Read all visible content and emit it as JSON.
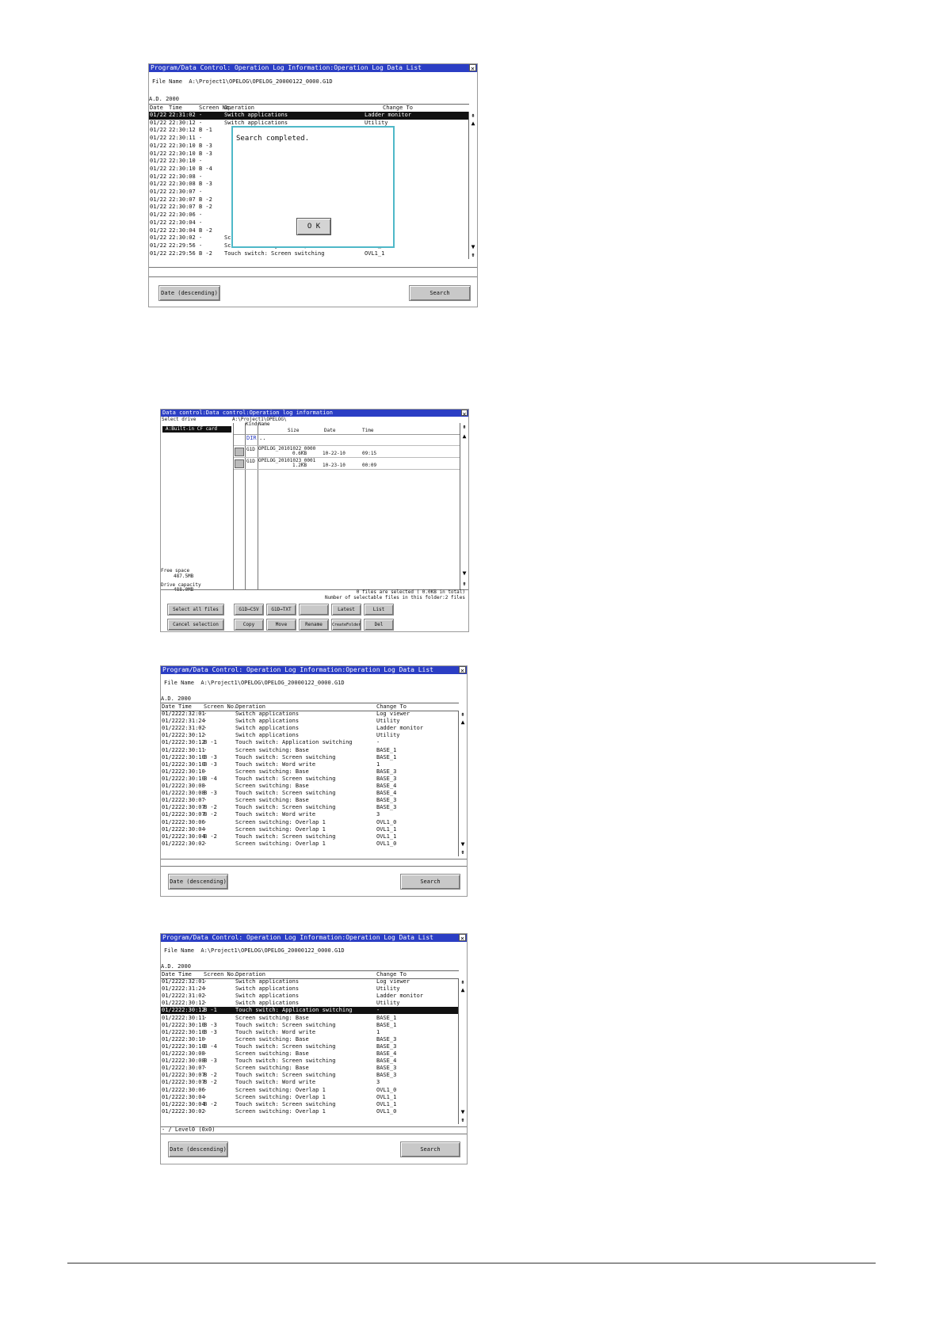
{
  "screen1": {
    "title": "Program/Data Control: Operation Log Information:Operation Log Data List",
    "file_name_label": "File Name",
    "file_name_value": "A:\\Project1\\OPELOG\\OPELOG_20000122_0000.G1D",
    "year": "A.D. 2000",
    "columns": {
      "date": "Date",
      "time": "Time",
      "screen": "Screen No.",
      "operation": "Operation",
      "change": "Change To"
    },
    "rows": [
      {
        "date": "01/22",
        "time": "22:31:02",
        "screen": "-",
        "op": "Switch applications",
        "chg": "Ladder monitor"
      },
      {
        "date": "01/22",
        "time": "22:30:12",
        "screen": "-",
        "op": "Switch applications",
        "chg": "Utility"
      },
      {
        "date": "01/22",
        "time": "22:30:12",
        "screen": "B -1",
        "op": "",
        "chg": ""
      },
      {
        "date": "01/22",
        "time": "22:30:11",
        "screen": "-",
        "op": "",
        "chg": "1"
      },
      {
        "date": "01/22",
        "time": "22:30:10",
        "screen": "B -3",
        "op": "",
        "chg": "1"
      },
      {
        "date": "01/22",
        "time": "22:30:10",
        "screen": "B -3",
        "op": "",
        "chg": ""
      },
      {
        "date": "01/22",
        "time": "22:30:10",
        "screen": "-",
        "op": "",
        "chg": "3"
      },
      {
        "date": "01/22",
        "time": "22:30:10",
        "screen": "B -4",
        "op": "",
        "chg": "3"
      },
      {
        "date": "01/22",
        "time": "22:30:08",
        "screen": "-",
        "op": "",
        "chg": "4"
      },
      {
        "date": "01/22",
        "time": "22:30:08",
        "screen": "B -3",
        "op": "",
        "chg": "4"
      },
      {
        "date": "01/22",
        "time": "22:30:07",
        "screen": "-",
        "op": "",
        "chg": "3"
      },
      {
        "date": "01/22",
        "time": "22:30:07",
        "screen": "B -2",
        "op": "",
        "chg": "3"
      },
      {
        "date": "01/22",
        "time": "22:30:07",
        "screen": "B -2",
        "op": "",
        "chg": ""
      },
      {
        "date": "01/22",
        "time": "22:30:06",
        "screen": "-",
        "op": "",
        "chg": "0"
      },
      {
        "date": "01/22",
        "time": "22:30:04",
        "screen": "-",
        "op": "",
        "chg": "1"
      },
      {
        "date": "01/22",
        "time": "22:30:04",
        "screen": "B -2",
        "op": "",
        "chg": "1"
      },
      {
        "date": "01/22",
        "time": "22:30:02",
        "screen": "-",
        "op": "Screen switching: Overlap 1",
        "chg": "OVL1_0"
      },
      {
        "date": "01/22",
        "time": "22:29:56",
        "screen": "-",
        "op": "Screen switching: Overlap 1",
        "chg": "OVL1_1"
      },
      {
        "date": "01/22",
        "time": "22:29:56",
        "screen": "B -2",
        "op": "Touch switch: Screen switching",
        "chg": "OVL1_1"
      }
    ],
    "dialog_message": "Search completed.",
    "dialog_ok": "O K",
    "sort_button": "Date (descending)",
    "search_button": "Search"
  },
  "screen2": {
    "title": "Data control:Data control:Operation log information",
    "select_drive_label": "Select drive",
    "drive_item": "A:Built-in CF card",
    "path": "A:\\Project1\\OPELOG\\",
    "col_kind": "Kind",
    "col_name": "Name",
    "col_size": "Size",
    "col_date": "Date",
    "col_time": "Time",
    "dir_kind": "DIR",
    "dir_name": "..",
    "files": [
      {
        "kind": "G1D",
        "name": "OPELOG_20101022_0000",
        "size": "0.6KB",
        "date": "10-22-10",
        "time": "09:15"
      },
      {
        "kind": "G1D",
        "name": "OPELOG_20101023_0001",
        "size": "1.2KB",
        "date": "10-23-10",
        "time": "00:09"
      }
    ],
    "free_space_label": "Free space",
    "free_space_value": "487.5MB",
    "drive_capacity_label": "Drive capacity",
    "drive_capacity_value": "488.0MB",
    "selected_text": "0 files are selected (   0.0KB in total)",
    "selectable_text": "Number of selectable files in this folder:2 files",
    "buttons_row1": [
      "Select all files",
      "G1D→CSV",
      "G1D→TXT",
      "",
      "Latest",
      "List"
    ],
    "buttons_row2": [
      "Cancel selection",
      "Copy",
      "Move",
      "Rename",
      "CreateFolder",
      "Del"
    ]
  },
  "screen3": {
    "title": "Program/Data Control: Operation Log Information:Operation Log Data List",
    "file_name_label": "File Name",
    "file_name_value": "A:\\Project1\\OPELOG\\OPELOG_20000122_0000.G1D",
    "year": "A.D. 2000",
    "columns": {
      "date": "Date",
      "time": "Time",
      "screen": "Screen No.",
      "operation": "Operation",
      "change": "Change To"
    },
    "rows": [
      {
        "date": "01/22",
        "time": "22:32:01",
        "screen": "-",
        "op": "Switch applications",
        "chg": "Log viewer"
      },
      {
        "date": "01/22",
        "time": "22:31:24",
        "screen": "-",
        "op": "Switch applications",
        "chg": "Utility"
      },
      {
        "date": "01/22",
        "time": "22:31:02",
        "screen": "-",
        "op": "Switch applications",
        "chg": "Ladder monitor"
      },
      {
        "date": "01/22",
        "time": "22:30:12",
        "screen": "-",
        "op": "Switch applications",
        "chg": "Utility"
      },
      {
        "date": "01/22",
        "time": "22:30:12",
        "screen": "B -1",
        "op": "Touch switch: Application switching",
        "chg": "-"
      },
      {
        "date": "01/22",
        "time": "22:30:11",
        "screen": "-",
        "op": "Screen switching: Base",
        "chg": "BASE_1"
      },
      {
        "date": "01/22",
        "time": "22:30:10",
        "screen": "B -3",
        "op": "Touch switch: Screen switching",
        "chg": "BASE_1"
      },
      {
        "date": "01/22",
        "time": "22:30:10",
        "screen": "B -3",
        "op": "Touch switch: Word write",
        "chg": "1"
      },
      {
        "date": "01/22",
        "time": "22:30:10",
        "screen": "-",
        "op": "Screen switching: Base",
        "chg": "BASE_3"
      },
      {
        "date": "01/22",
        "time": "22:30:10",
        "screen": "B -4",
        "op": "Touch switch: Screen switching",
        "chg": "BASE_3"
      },
      {
        "date": "01/22",
        "time": "22:30:08",
        "screen": "-",
        "op": "Screen switching: Base",
        "chg": "BASE_4"
      },
      {
        "date": "01/22",
        "time": "22:30:08",
        "screen": "B -3",
        "op": "Touch switch: Screen switching",
        "chg": "BASE_4"
      },
      {
        "date": "01/22",
        "time": "22:30:07",
        "screen": "-",
        "op": "Screen switching: Base",
        "chg": "BASE_3"
      },
      {
        "date": "01/22",
        "time": "22:30:07",
        "screen": "B -2",
        "op": "Touch switch: Screen switching",
        "chg": "BASE_3"
      },
      {
        "date": "01/22",
        "time": "22:30:07",
        "screen": "B -2",
        "op": "Touch switch: Word write",
        "chg": "3"
      },
      {
        "date": "01/22",
        "time": "22:30:06",
        "screen": "-",
        "op": "Screen switching: Overlap 1",
        "chg": "OVL1_0"
      },
      {
        "date": "01/22",
        "time": "22:30:04",
        "screen": "-",
        "op": "Screen switching: Overlap 1",
        "chg": "OVL1_1"
      },
      {
        "date": "01/22",
        "time": "22:30:04",
        "screen": "B -2",
        "op": "Touch switch: Screen switching",
        "chg": "OVL1_1"
      },
      {
        "date": "01/22",
        "time": "22:30:02",
        "screen": "-",
        "op": "Screen switching: Overlap 1",
        "chg": "OVL1_0"
      }
    ],
    "status_text": "",
    "sort_button": "Date (descending)",
    "search_button": "Search"
  },
  "screen4": {
    "title": "Program/Data Control: Operation Log Information:Operation Log Data List",
    "file_name_label": "File Name",
    "file_name_value": "A:\\Project1\\OPELOG\\OPELOG_20000122_0000.G1D",
    "year": "A.D. 2000",
    "columns": {
      "date": "Date",
      "time": "Time",
      "screen": "Screen No.",
      "operation": "Operation",
      "change": "Change To"
    },
    "rows": [
      {
        "date": "01/22",
        "time": "22:32:01",
        "screen": "-",
        "op": "Switch applications",
        "chg": "Log viewer"
      },
      {
        "date": "01/22",
        "time": "22:31:24",
        "screen": "-",
        "op": "Switch applications",
        "chg": "Utility"
      },
      {
        "date": "01/22",
        "time": "22:31:02",
        "screen": "-",
        "op": "Switch applications",
        "chg": "Ladder monitor"
      },
      {
        "date": "01/22",
        "time": "22:30:12",
        "screen": "-",
        "op": "Switch applications",
        "chg": "Utility"
      },
      {
        "date": "01/22",
        "time": "22:30:12",
        "screen": "B -1",
        "op": "Touch switch: Application switching",
        "chg": "-"
      },
      {
        "date": "01/22",
        "time": "22:30:11",
        "screen": "-",
        "op": "Screen switching: Base",
        "chg": "BASE_1"
      },
      {
        "date": "01/22",
        "time": "22:30:10",
        "screen": "B -3",
        "op": "Touch switch: Screen switching",
        "chg": "BASE_1"
      },
      {
        "date": "01/22",
        "time": "22:30:10",
        "screen": "B -3",
        "op": "Touch switch: Word write",
        "chg": "1"
      },
      {
        "date": "01/22",
        "time": "22:30:10",
        "screen": "-",
        "op": "Screen switching: Base",
        "chg": "BASE_3"
      },
      {
        "date": "01/22",
        "time": "22:30:10",
        "screen": "B -4",
        "op": "Touch switch: Screen switching",
        "chg": "BASE_3"
      },
      {
        "date": "01/22",
        "time": "22:30:08",
        "screen": "-",
        "op": "Screen switching: Base",
        "chg": "BASE_4"
      },
      {
        "date": "01/22",
        "time": "22:30:08",
        "screen": "B -3",
        "op": "Touch switch: Screen switching",
        "chg": "BASE_4"
      },
      {
        "date": "01/22",
        "time": "22:30:07",
        "screen": "-",
        "op": "Screen switching: Base",
        "chg": "BASE_3"
      },
      {
        "date": "01/22",
        "time": "22:30:07",
        "screen": "B -2",
        "op": "Touch switch: Screen switching",
        "chg": "BASE_3"
      },
      {
        "date": "01/22",
        "time": "22:30:07",
        "screen": "B -2",
        "op": "Touch switch: Word write",
        "chg": "3"
      },
      {
        "date": "01/22",
        "time": "22:30:06",
        "screen": "-",
        "op": "Screen switching: Overlap 1",
        "chg": "OVL1_0"
      },
      {
        "date": "01/22",
        "time": "22:30:04",
        "screen": "-",
        "op": "Screen switching: Overlap 1",
        "chg": "OVL1_1"
      },
      {
        "date": "01/22",
        "time": "22:30:04",
        "screen": "B -2",
        "op": "Touch switch: Screen switching",
        "chg": "OVL1_1"
      },
      {
        "date": "01/22",
        "time": "22:30:02",
        "screen": "-",
        "op": "Screen switching: Overlap 1",
        "chg": "OVL1_0"
      }
    ],
    "status_text": "- / Level0 (0x0)",
    "sort_button": "Date (descending)",
    "search_button": "Search"
  },
  "colors": {
    "titlebar": "#2b3ec4",
    "dialog_border": "#4fb8c8",
    "selected_row": "#111111",
    "button": "#c8c8c8"
  }
}
